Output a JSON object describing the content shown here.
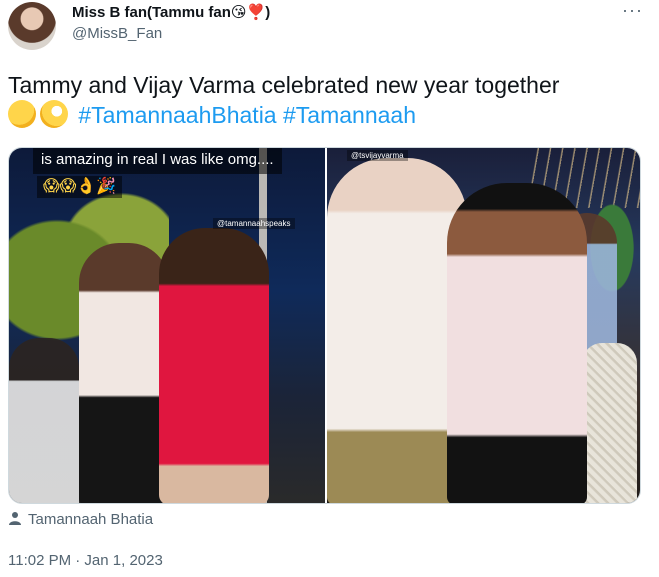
{
  "author": {
    "name": "Miss B fan(Tammu fan😘❣️)",
    "handle": "@MissB_Fan"
  },
  "menu": {
    "more_label": "···"
  },
  "tweet": {
    "text": "Tammy and Vijay Varma celebrated new year together",
    "emojis": "🤔🧐",
    "hashtags": [
      "#TamannaahBhatia",
      "#Tamannaah"
    ]
  },
  "media": {
    "left_caption": "is amazing in real I was like omg....",
    "left_emojis": "😱😱👌🎉",
    "left_watermark": "@tamannaahspeaks",
    "right_watermark": "@tsvijayvarma"
  },
  "tagged": {
    "label": "Tamannaah Bhatia",
    "icon": "person-icon"
  },
  "timestamp": "11:02 PM · Jan 1, 2023",
  "colors": {
    "link": "#1d9bf0",
    "muted": "#536471",
    "text": "#0f1419"
  }
}
